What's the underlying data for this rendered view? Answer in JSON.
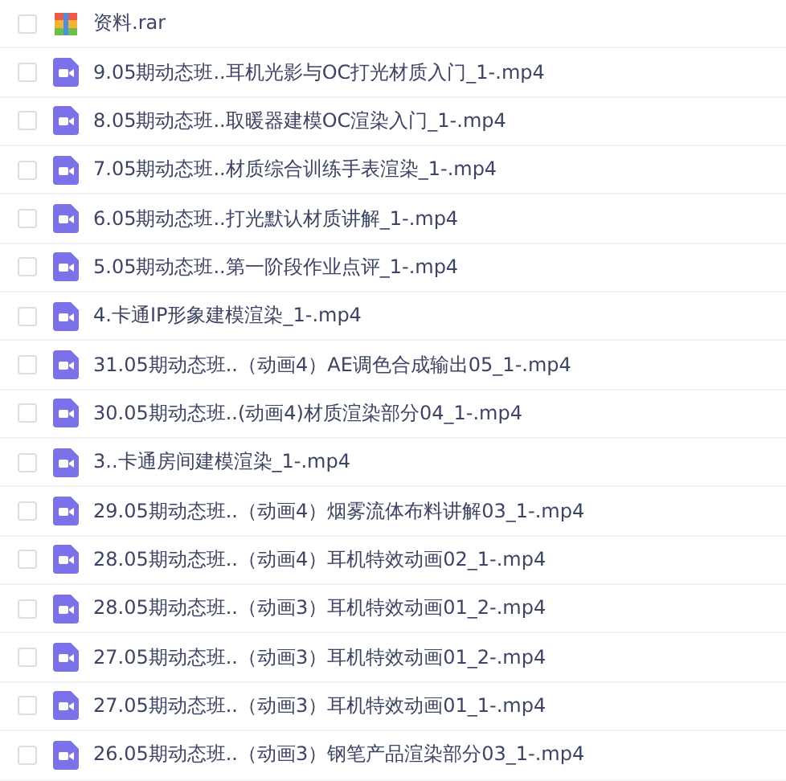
{
  "files": [
    {
      "name": "资料.rar",
      "kind": "archive",
      "checked": false
    },
    {
      "name": "9.05期动态班..耳机光影与OC打光材质入门_1-.mp4",
      "kind": "video",
      "checked": false
    },
    {
      "name": "8.05期动态班..取暖器建模OC渲染入门_1-.mp4",
      "kind": "video",
      "checked": false
    },
    {
      "name": "7.05期动态班..材质综合训练手表渲染_1-.mp4",
      "kind": "video",
      "checked": false
    },
    {
      "name": "6.05期动态班..打光默认材质讲解_1-.mp4",
      "kind": "video",
      "checked": false
    },
    {
      "name": "5.05期动态班..第一阶段作业点评_1-.mp4",
      "kind": "video",
      "checked": false
    },
    {
      "name": "4.卡通IP形象建模渲染_1-.mp4",
      "kind": "video",
      "checked": false
    },
    {
      "name": "31.05期动态班..（动画4）AE调色合成输出05_1-.mp4",
      "kind": "video",
      "checked": false
    },
    {
      "name": "30.05期动态班..(动画4)材质渲染部分04_1-.mp4",
      "kind": "video",
      "checked": false
    },
    {
      "name": "3..卡通房间建模渲染_1-.mp4",
      "kind": "video",
      "checked": false
    },
    {
      "name": "29.05期动态班..（动画4）烟雾流体布料讲解03_1-.mp4",
      "kind": "video",
      "checked": false
    },
    {
      "name": "28.05期动态班..（动画4）耳机特效动画02_1-.mp4",
      "kind": "video",
      "checked": false
    },
    {
      "name": "28.05期动态班..（动画3）耳机特效动画01_2-.mp4",
      "kind": "video",
      "checked": false
    },
    {
      "name": "27.05期动态班..（动画3）耳机特效动画01_2-.mp4",
      "kind": "video",
      "checked": false
    },
    {
      "name": "27.05期动态班..（动画3）耳机特效动画01_1-.mp4",
      "kind": "video",
      "checked": false
    },
    {
      "name": "26.05期动态班..（动画3）钢笔产品渲染部分03_1-.mp4",
      "kind": "video",
      "checked": false
    }
  ]
}
